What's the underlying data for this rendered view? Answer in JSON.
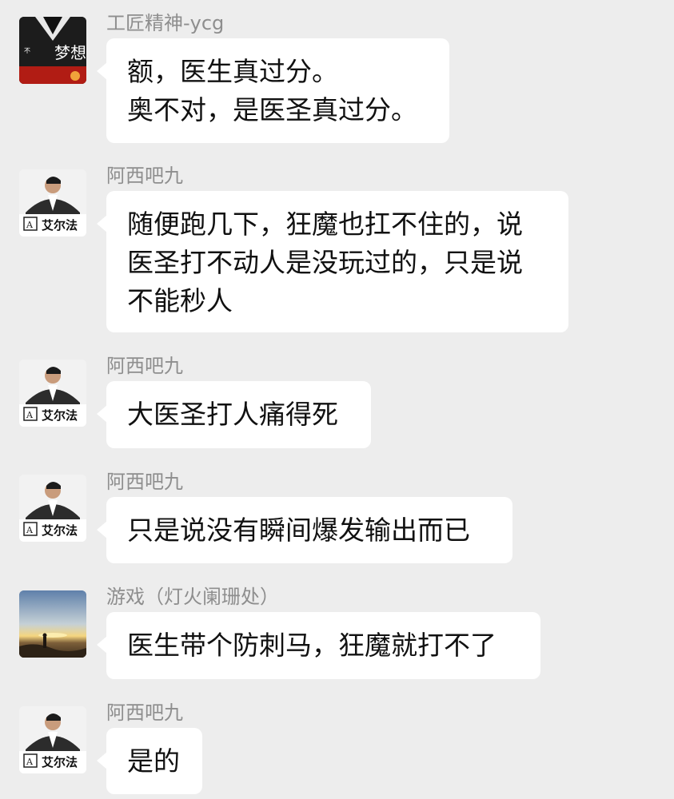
{
  "messages": [
    {
      "sender": "工匠精神-ycg",
      "lines": [
        "额，医生真过分。",
        "奥不对，是医圣真过分。"
      ],
      "avatar": "red-black-poster-avatar"
    },
    {
      "sender": "阿西吧九",
      "lines": [
        "随便跑几下，狂魔也扛不住的，说",
        "医圣打不动人是没玩过的，只是说",
        "不能秒人"
      ],
      "avatar": "man-in-suit-avatar",
      "avatar_brand": "艾尔法"
    },
    {
      "sender": "阿西吧九",
      "lines": [
        "大医圣打人痛得死"
      ],
      "avatar": "man-in-suit-avatar",
      "avatar_brand": "艾尔法"
    },
    {
      "sender": "阿西吧九",
      "lines": [
        "只是说没有瞬间爆发输出而已"
      ],
      "avatar": "man-in-suit-avatar",
      "avatar_brand": "艾尔法"
    },
    {
      "sender": "游戏（灯火阑珊处）",
      "lines": [
        "医生带个防刺马，狂魔就打不了"
      ],
      "avatar": "sunset-landscape-avatar"
    },
    {
      "sender": "阿西吧九",
      "lines": [
        "是的"
      ],
      "avatar": "man-in-suit-avatar",
      "avatar_brand": "艾尔法"
    }
  ],
  "avatar_1_text": [
    "梦想"
  ],
  "colors": {
    "background": "#ededed",
    "bubble": "#ffffff",
    "sender": "#8e8e8e",
    "text": "#111111"
  }
}
